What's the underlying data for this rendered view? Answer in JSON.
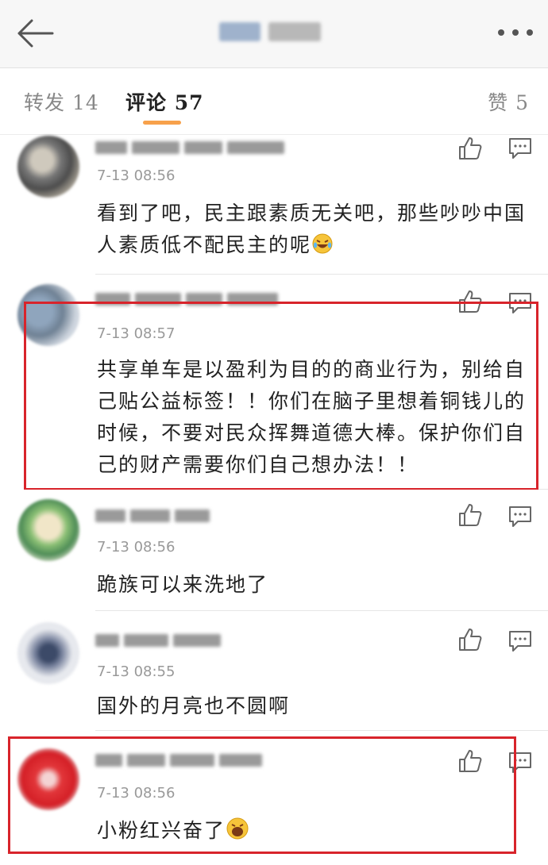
{
  "header": {
    "back_icon": "arrow-left-icon",
    "more_icon": "more-dots-icon"
  },
  "tabs": {
    "repost": "转发 14",
    "comments": "评论 57",
    "likes": "赞 5"
  },
  "comments": [
    {
      "time": "7-13 08:56",
      "text": "看到了吧，民主跟素质无关吧，那些吵吵中国人素质低不配民主的呢"
    },
    {
      "time": "7-13 08:57",
      "text": "共享单车是以盈利为目的的商业行为，别给自己贴公益标签！！你们在脑子里想着铜钱儿的时候，不要对民众挥舞道德大棒。保护你们自己的财产需要你们自己想办法！！"
    },
    {
      "time": "7-13 08:56",
      "text": "跪族可以来洗地了"
    },
    {
      "time": "7-13 08:55",
      "text": "国外的月亮也不圆啊"
    },
    {
      "time": "7-13 08:56",
      "text": "小粉红兴奋了"
    }
  ],
  "colors": {
    "highlight_box": "#d8242b",
    "tab_accent": "#f7a14b"
  }
}
